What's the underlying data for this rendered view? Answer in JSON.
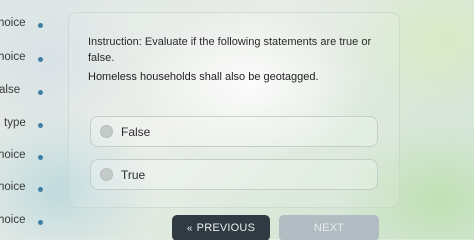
{
  "sidebar": {
    "steps": [
      {
        "label": "hoice"
      },
      {
        "label": "hoice"
      },
      {
        "label": "alse"
      },
      {
        "label": "type"
      },
      {
        "label": "hoice"
      },
      {
        "label": "hoice"
      },
      {
        "label": "hoice"
      }
    ]
  },
  "question": {
    "instruction_label": "Instruction:",
    "instruction_text": "Evaluate if the following statements are true or false.",
    "statement": "Homeless households shall also be geotagged.",
    "options": [
      {
        "label": "False"
      },
      {
        "label": "True"
      }
    ]
  },
  "nav": {
    "prev_label": "PREVIOUS",
    "next_label": "NEXT"
  },
  "colors": {
    "step_dot": "#3f7fa3",
    "prev_button": "#2f3a42",
    "next_button_disabled": "#b2bcc3"
  }
}
